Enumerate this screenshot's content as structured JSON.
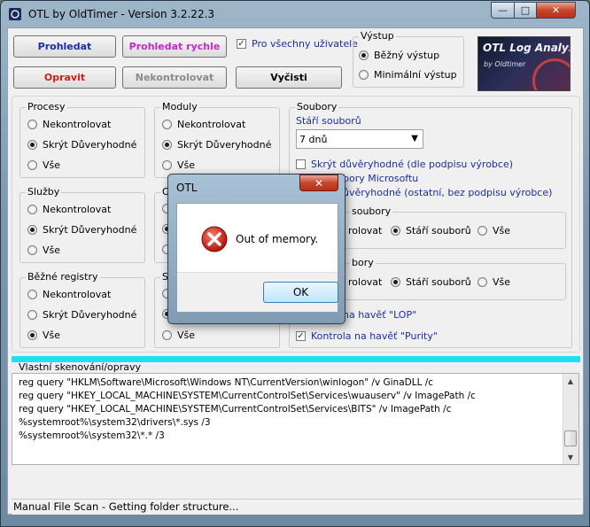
{
  "window": {
    "title": "OTL by OldTimer - Version 3.2.22.3",
    "min": "—",
    "max": "□",
    "close": "✕"
  },
  "toolbar": {
    "prohledat": "Prohledat",
    "prohledat_rychle": "Prohledat rychle",
    "opravit": "Opravit",
    "nekontrolovat": "Nekontrolovat",
    "vycisti": "Vyčisti",
    "all_users_label": "Pro všechny uživatele",
    "all_users_checked": true
  },
  "vystup": {
    "title": "Výstup",
    "options": [
      "Běžný výstup",
      "Minimální výstup"
    ],
    "selected": 0
  },
  "logo": {
    "title": "OTL Log Analysis",
    "subtitle": "by Oldtimer"
  },
  "procesy": {
    "title": "Procesy",
    "options": [
      "Nekontrolovat",
      "Skrýt Důveryhodné",
      "Vše"
    ],
    "selected": 1
  },
  "sluzby": {
    "title": "Služby",
    "options": [
      "Nekontrolovat",
      "Skrýt Důveryhodné",
      "Vše"
    ],
    "selected": 1
  },
  "registry": {
    "title": "Běžné registry",
    "options": [
      "Nekontrolovat",
      "Skrýt Důveryhodné",
      "Vše"
    ],
    "selected": 2
  },
  "moduly": {
    "title": "Moduly",
    "options": [
      "Nekontrolovat",
      "Skrýt Důveryhodné",
      "Vše"
    ],
    "selected": 1
  },
  "ov_group": {
    "title": "Ov",
    "options": [
      "",
      "",
      ""
    ],
    "selected": 1
  },
  "sp_group": {
    "title": "Sp",
    "options": [
      "",
      "",
      "Vše"
    ],
    "selected": 1
  },
  "soubory": {
    "title": "Soubory",
    "age_label": "Stáří souborů",
    "age_value": "7 dnů",
    "hide_trusted_signed": "Skrýt důvěryhodné (dle podpisu výrobce)",
    "hide_ms_partial": "bory Microsoftu",
    "hide_trusted_unsigned_partial": "ůvěryhodné (ostatní, bez podpisu výrobce)",
    "sub1_title_partial": "soubory",
    "sub1_opts": [
      "rolovat",
      "Stáří souborů",
      "Vše"
    ],
    "sub1_selected": 1,
    "sub2_title_partial": "bory",
    "sub2_opts": [
      "rolovat",
      "Stáří souborů",
      "Vše"
    ],
    "sub2_selected": 1,
    "lop_partial": "na havěť \"LOP\"",
    "purity_label": "Kontrola na havěť \"Purity\"",
    "purity_checked": true
  },
  "custom": {
    "title": "Vlastní skenování/opravy",
    "lines": [
      "reg query \"HKLM\\Software\\Microsoft\\Windows NT\\CurrentVersion\\winlogon\" /v GinaDLL /c",
      "reg query \"HKEY_LOCAL_MACHINE\\SYSTEM\\CurrentControlSet\\Services\\wuauserv\" /v ImagePath /c",
      "reg query \"HKEY_LOCAL_MACHINE\\SYSTEM\\CurrentControlSet\\Services\\BITS\" /v ImagePath /c",
      "%systemroot%\\system32\\drivers\\*.sys /3",
      "%systemroot%\\system32\\*.* /3"
    ]
  },
  "status": "Manual File Scan - Getting folder structure...",
  "dialog": {
    "title": "OTL",
    "close": "✕",
    "message": "Out of memory.",
    "ok": "OK"
  }
}
